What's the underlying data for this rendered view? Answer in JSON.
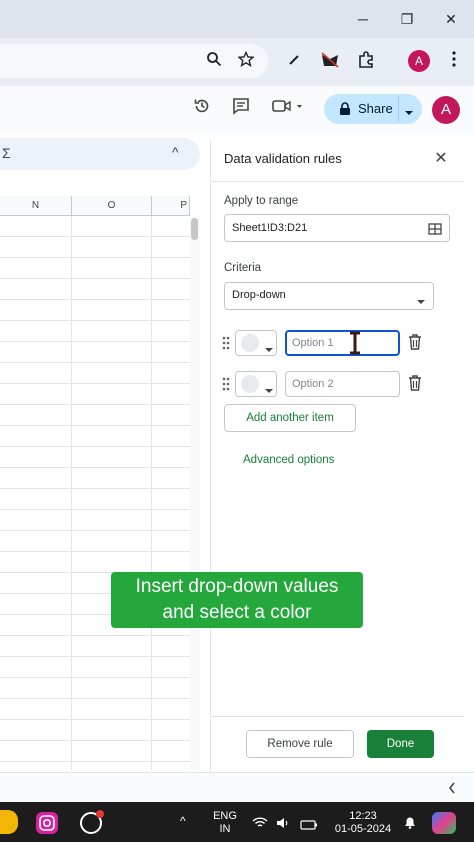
{
  "window": {
    "minimize": "─",
    "restore": "❐",
    "close": "✕"
  },
  "browser": {
    "avatar_letter": "A"
  },
  "sheets_header": {
    "share_label": "Share",
    "avatar_letter": "A"
  },
  "formula_bar": {
    "sigma": "Σ",
    "collapse": "^"
  },
  "grid": {
    "columns": [
      "N",
      "O",
      "P"
    ]
  },
  "panel": {
    "title": "Data validation rules",
    "apply_label": "Apply to range",
    "range_value": "Sheet1!D3:D21",
    "criteria_label": "Criteria",
    "criteria_value": "Drop-down",
    "items": [
      {
        "placeholder": "Option 1"
      },
      {
        "placeholder": "Option 2"
      }
    ],
    "add_item": "Add another item",
    "advanced": "Advanced options",
    "remove_rule": "Remove rule",
    "done": "Done",
    "accent": "#188038"
  },
  "caption": {
    "line1": "Insert drop-down values",
    "line2": "and select a color"
  },
  "taskbar": {
    "lang1": "ENG",
    "lang2": "IN",
    "time": "12:23",
    "date": "01-05-2024",
    "chevron": "^"
  }
}
